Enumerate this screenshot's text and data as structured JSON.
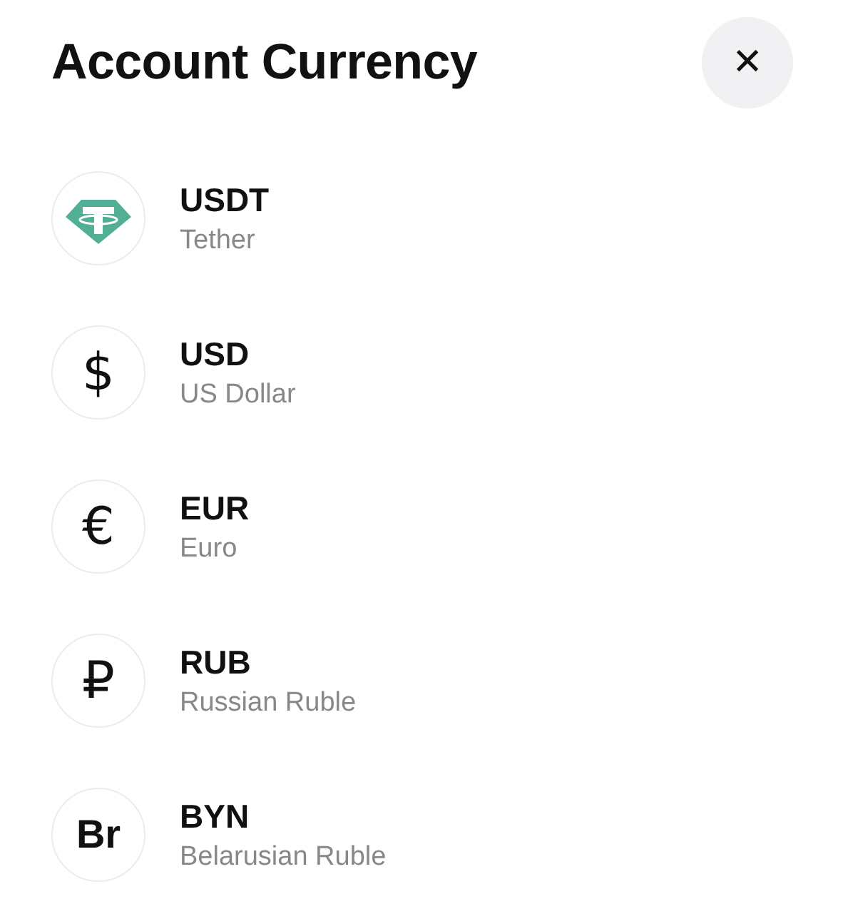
{
  "title": "Account Currency",
  "close": {
    "symbol": "✕"
  },
  "currencies": [
    {
      "kind": "logo",
      "code": "USDT",
      "name": "Tether"
    },
    {
      "kind": "glyph",
      "symbol": "$",
      "code": "USD",
      "name": "US Dollar"
    },
    {
      "kind": "glyph",
      "symbol": "€",
      "code": "EUR",
      "name": "Euro"
    },
    {
      "kind": "glyph",
      "symbol": "₽",
      "code": "RUB",
      "name": "Russian Ruble"
    },
    {
      "kind": "text",
      "symbol": "Br",
      "code": "BYN",
      "name": "Belarusian Ruble"
    }
  ]
}
